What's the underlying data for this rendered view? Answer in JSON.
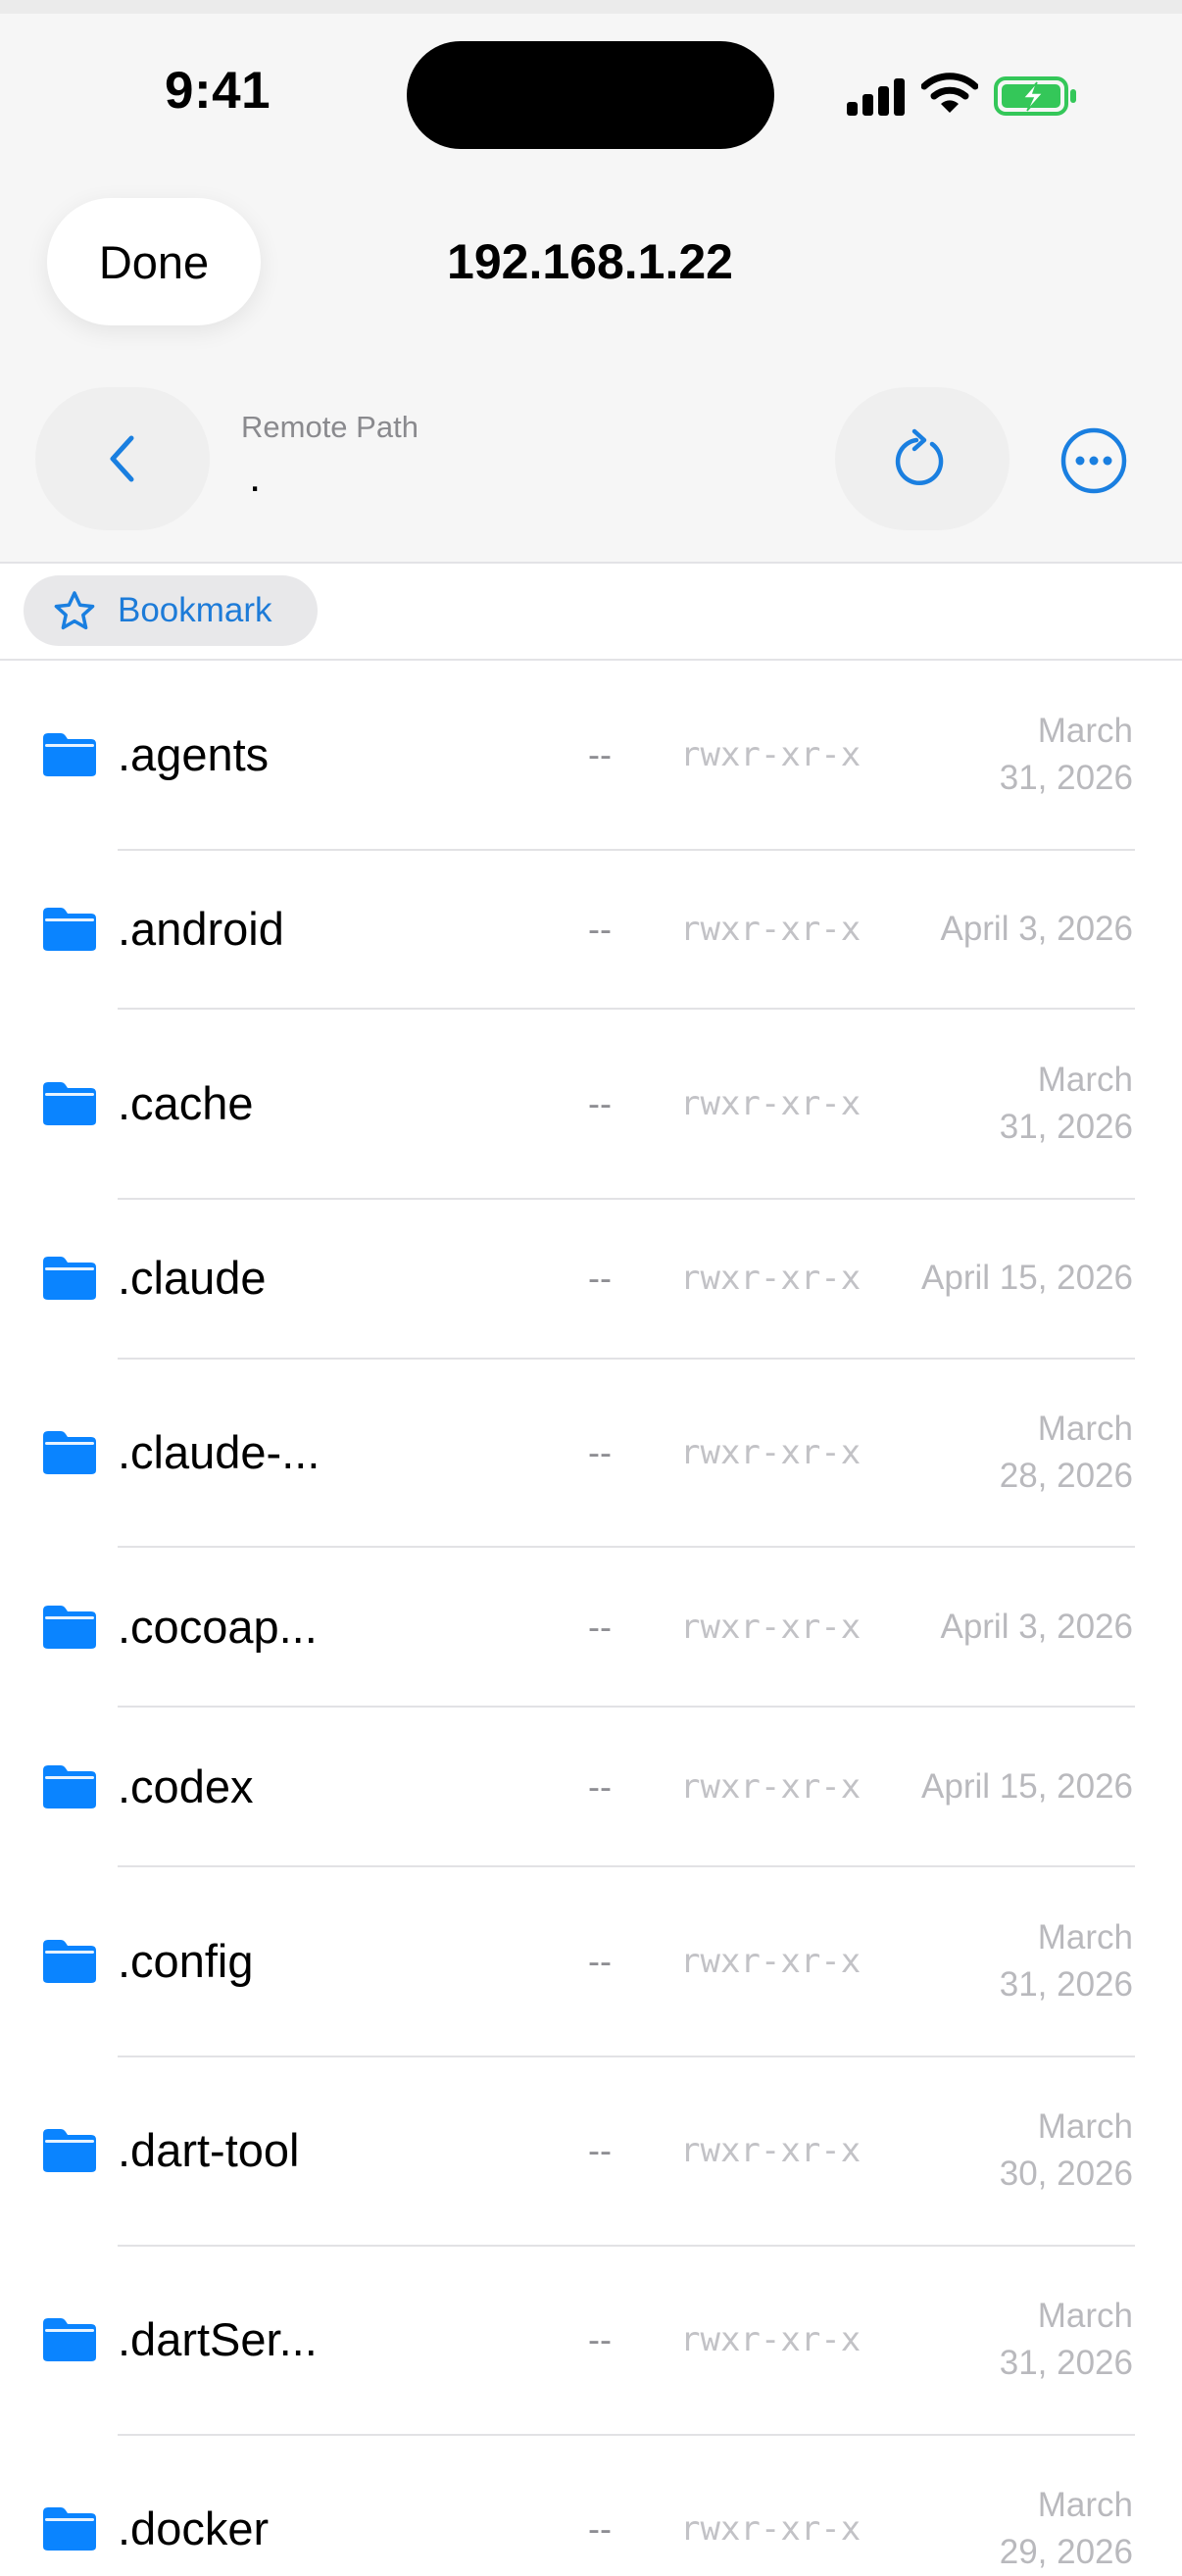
{
  "status_bar": {
    "time": "9:41"
  },
  "nav": {
    "done_label": "Done",
    "title": "192.168.1.22"
  },
  "path_bar": {
    "label": "Remote Path",
    "value": "."
  },
  "bookmark": {
    "label": "Bookmark"
  },
  "colors": {
    "accent": "#1a7fe0",
    "folder": "#0a84ff",
    "battery": "#34c759"
  },
  "files": [
    {
      "name": ".agents",
      "size": "--",
      "permissions": "rwxr-xr-x",
      "date_line1": "March",
      "date_line2": "31, 2026"
    },
    {
      "name": ".android",
      "size": "--",
      "permissions": "rwxr-xr-x",
      "date_line1": "April 3, 2026",
      "date_line2": ""
    },
    {
      "name": ".cache",
      "size": "--",
      "permissions": "rwxr-xr-x",
      "date_line1": "March",
      "date_line2": "31, 2026"
    },
    {
      "name": ".claude",
      "size": "--",
      "permissions": "rwxr-xr-x",
      "date_line1": "April 15, 2026",
      "date_line2": ""
    },
    {
      "name": ".claude-...",
      "size": "--",
      "permissions": "rwxr-xr-x",
      "date_line1": "March",
      "date_line2": "28, 2026"
    },
    {
      "name": ".cocoap...",
      "size": "--",
      "permissions": "rwxr-xr-x",
      "date_line1": "April 3, 2026",
      "date_line2": ""
    },
    {
      "name": ".codex",
      "size": "--",
      "permissions": "rwxr-xr-x",
      "date_line1": "April 15, 2026",
      "date_line2": ""
    },
    {
      "name": ".config",
      "size": "--",
      "permissions": "rwxr-xr-x",
      "date_line1": "March",
      "date_line2": "31, 2026"
    },
    {
      "name": ".dart-tool",
      "size": "--",
      "permissions": "rwxr-xr-x",
      "date_line1": "March",
      "date_line2": "30, 2026"
    },
    {
      "name": ".dartSer...",
      "size": "--",
      "permissions": "rwxr-xr-x",
      "date_line1": "March",
      "date_line2": "31, 2026"
    },
    {
      "name": ".docker",
      "size": "--",
      "permissions": "rwxr-xr-x",
      "date_line1": "March",
      "date_line2": "29, 2026"
    }
  ]
}
